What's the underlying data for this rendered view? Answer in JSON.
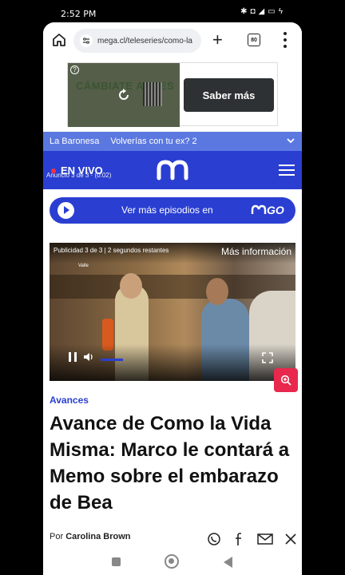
{
  "status_bar": {
    "time": "2:52 PM",
    "icons": [
      "bluetooth-icon",
      "alarm-icon",
      "signal-icon",
      "battery-icon",
      "charging-icon"
    ]
  },
  "browser": {
    "url": "mega.cl/teleseries/como-la",
    "tab_count": "80"
  },
  "ad": {
    "brand_text": "CÁMBIATE ANDES",
    "button_label": "Saber más"
  },
  "trending": {
    "items": [
      "La Baronesa",
      "Volverías con tu ex? 2"
    ]
  },
  "header": {
    "live_label": "EN VIVO"
  },
  "promo": {
    "text": "Ver más episodios en",
    "logo_text": "GO"
  },
  "video": {
    "ad_counter": "Publicidad 3 de 3 | 2 segundos restantes",
    "more_info": "Más información",
    "brand_watermark": "Valle",
    "ad_progress": "Anuncio 3 de 3 · (0:02)"
  },
  "article": {
    "category": "Avances",
    "headline": "Avance de Como la Vida Misma: Marco le contará a Memo sobre el embarazo de Bea",
    "byline_prefix": "Por",
    "author": "Carolina Brown"
  },
  "colors": {
    "brand_blue": "#2a3fd1",
    "trend_blue": "#5b78e0",
    "zoom_red": "#e8284d",
    "live_red": "#ff3040"
  }
}
